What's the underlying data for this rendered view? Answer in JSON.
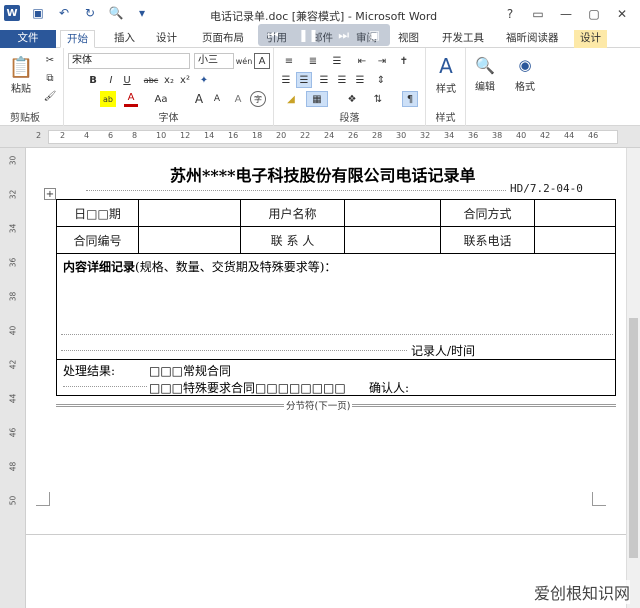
{
  "window": {
    "title": "电话记录单.doc [兼容模式] - Microsoft Word",
    "controls": [
      "?",
      "▭",
      "—",
      "▢",
      "✕"
    ]
  },
  "qat": {
    "logo": "W"
  },
  "tabs": [
    "文件",
    "开始",
    "插入",
    "设计",
    "页面布局",
    "引用",
    "邮件",
    "审阅",
    "视图",
    "开发工具",
    "福昕阅读器",
    "设计"
  ],
  "ribbon": {
    "clipboard": {
      "label": "剪贴板",
      "paste": "粘贴"
    },
    "font": {
      "label": "字体",
      "font_name": "宋体",
      "font_size": "小三",
      "phonetic": "wén",
      "border_char": "A",
      "bold": "B",
      "italic": "I",
      "underline": "U",
      "strike": "abc",
      "sub": "x₂",
      "sup": "x²",
      "grow": "A",
      "shrink": "A",
      "case": "Aa",
      "clear": "A",
      "highlight": "ab",
      "color": "A"
    },
    "paragraph": {
      "label": "段落"
    },
    "styles": {
      "label": "样式",
      "styles_btn": "样式"
    },
    "editing": {
      "edit_btn": "编辑"
    },
    "format": {
      "format_btn": "格式"
    }
  },
  "ruler": {
    "h_marks": [
      "2",
      "2",
      "4",
      "6",
      "8",
      "10",
      "12",
      "14",
      "16",
      "18",
      "20",
      "22",
      "24",
      "26",
      "28",
      "30",
      "32",
      "34",
      "36",
      "38",
      "40",
      "42",
      "44",
      "46"
    ],
    "v_marks": [
      "30",
      "32",
      "34",
      "36",
      "38",
      "40",
      "42",
      "44",
      "46",
      "48",
      "50"
    ]
  },
  "document": {
    "title": "苏州****电子科技股份有限公司电话记录单",
    "code": "HD/7.2-04-0",
    "table": {
      "row1": [
        "日□□期",
        "",
        "用户名称",
        "",
        "合同方式",
        ""
      ],
      "row2": [
        "合同编号",
        "",
        "联 系 人",
        "",
        "联系电话",
        ""
      ]
    },
    "detail_bold": "内容详细记录",
    "detail_rest": "(规格、数量、交货期及特殊要求等)：",
    "recorder": "记录人/时间",
    "result_label": "处理结果:",
    "option1": "□□□常规合同",
    "option2": "□□□特殊要求合同□□□□□□□□",
    "confirm": "确认人:",
    "section_break": "分节符(下一页)"
  },
  "watermark": "爱创根知识网"
}
